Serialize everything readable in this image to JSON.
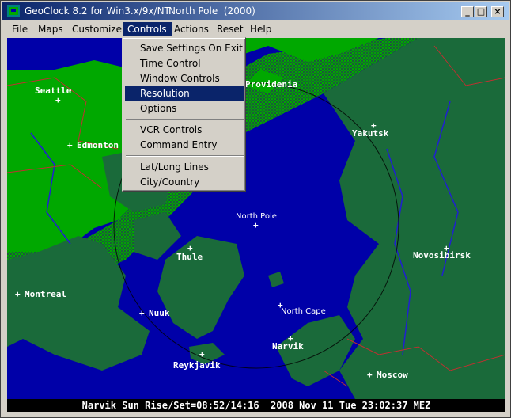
{
  "window": {
    "title": "GeoClock 8.2 for Win3.x/9x/NT",
    "subtitle": "North Pole  (2000)",
    "minimize_glyph": "_",
    "maximize_glyph": "□",
    "close_glyph": "×"
  },
  "menubar": {
    "items": [
      "File",
      "Maps",
      "Customize",
      "Controls",
      "Actions",
      "Reset",
      "Help"
    ],
    "active": "Controls"
  },
  "controls_menu": {
    "items": [
      "Save Settings On Exit",
      "Time Control",
      "Window Controls",
      "Resolution",
      "Options",
      "VCR Controls",
      "Command Entry",
      "Lat/Long Lines",
      "City/Country"
    ],
    "highlighted": "Resolution"
  },
  "map": {
    "cities": [
      "Seattle",
      "Edmonton",
      "Providenia",
      "Yakutsk",
      "North Pole",
      "Thule",
      "Novosibirsk",
      "Montreal",
      "Nuuk",
      "North Cape",
      "Narvik",
      "Reykjavik",
      "Moscow"
    ],
    "city_marker": "+"
  },
  "status": {
    "text": "Narvik Sun Rise/Set=08:52/14:16  2008 Nov 11 Tue 23:02:37 MEZ"
  },
  "colors": {
    "ocean": "#0000a8",
    "land_day": "#00a800",
    "land_night": "#005a2a",
    "titlebar": "#0a246a",
    "border_lines": "#c03030",
    "rivers": "#2020d0"
  }
}
